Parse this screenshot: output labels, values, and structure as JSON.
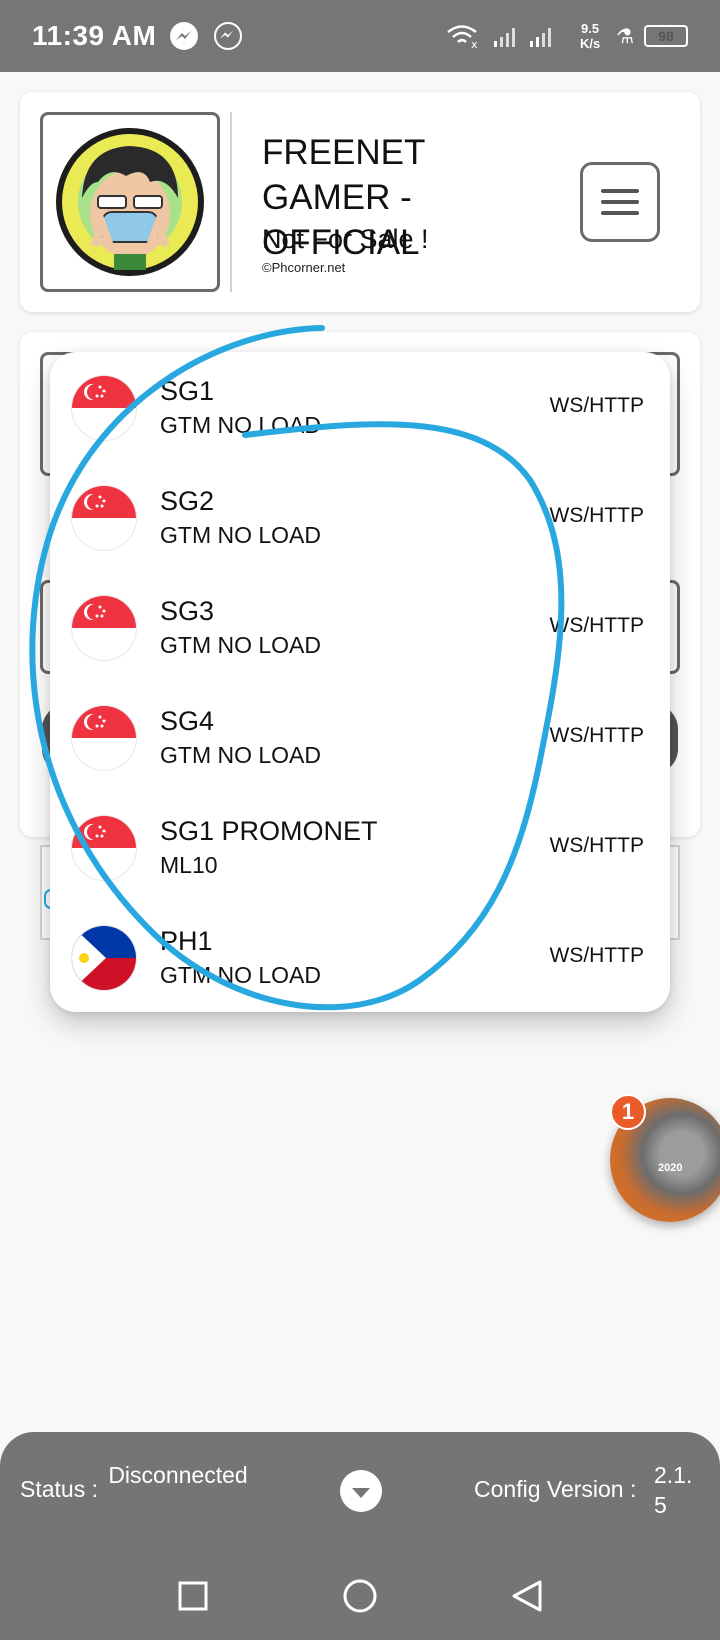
{
  "status_bar": {
    "time": "11:39 AM",
    "speed": "9.5\nK/s",
    "battery": "98",
    "icons": [
      "messenger-icon",
      "messenger-outline-icon",
      "wifi-icon",
      "signal-icon",
      "flask-icon",
      "battery-icon"
    ]
  },
  "header": {
    "title": "FREENET GAMER - OFFICIAL",
    "subtitle": "Not For Sale !",
    "copyright": "©Phcorner.net",
    "menu_icon": "hamburger-menu-icon"
  },
  "servers": [
    {
      "name": "SG1",
      "desc": "GTM NO LOAD",
      "proto": "WS/HTTP",
      "flag": "singapore-flag-icon"
    },
    {
      "name": "SG2",
      "desc": "GTM NO LOAD",
      "proto": "WS/HTTP",
      "flag": "singapore-flag-icon"
    },
    {
      "name": "SG3",
      "desc": "GTM NO LOAD",
      "proto": "WS/HTTP",
      "flag": "singapore-flag-icon"
    },
    {
      "name": "SG4",
      "desc": "GTM NO LOAD",
      "proto": "WS/HTTP",
      "flag": "singapore-flag-icon"
    },
    {
      "name": "SG1 PROMONET",
      "desc": "ML10",
      "proto": "WS/HTTP",
      "flag": "singapore-flag-icon"
    },
    {
      "name": "PH1",
      "desc": "GTM NO LOAD",
      "proto": "WS/HTTP",
      "flag": "philippines-flag-icon"
    }
  ],
  "chat_head": {
    "badge": "1",
    "year": "2020"
  },
  "bottom_bar": {
    "status_label": "Status :",
    "status_value": "Disconnected",
    "config_label": "Config Version :",
    "config_value": "2.1.5",
    "toggle_icon": "chevron-down-circle-icon"
  },
  "nav": {
    "icons": [
      "recents-square-icon",
      "home-circle-icon",
      "back-triangle-icon"
    ]
  },
  "colors": {
    "status_bar": "#767676",
    "bottom_bar": "#757575",
    "singapore_red": "#ef3340",
    "philippines_blue": "#0038a8",
    "philippines_red": "#ce1126",
    "annotation": "#29a8e0",
    "badge": "#ea5b2a"
  }
}
